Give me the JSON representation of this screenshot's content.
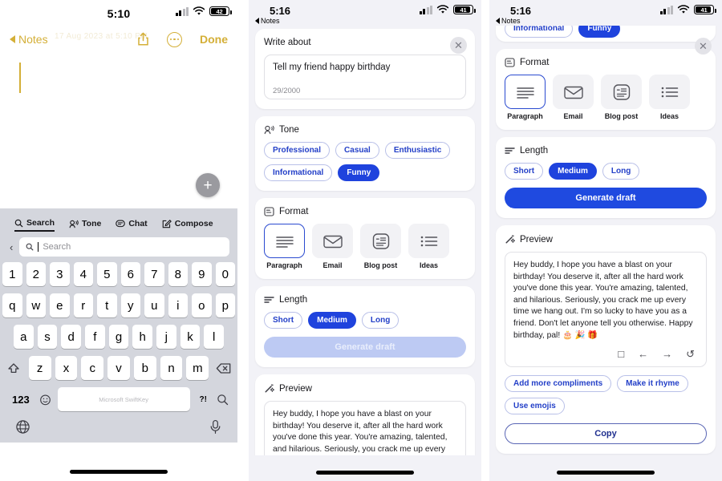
{
  "panel1": {
    "name": "notes-editor-with-keyboard",
    "status": {
      "time": "5:10",
      "battery_pct": "42",
      "signal_icon": "cellular-bars-icon",
      "wifi_icon": "wifi-icon",
      "battery_icon": "battery-icon"
    },
    "nav": {
      "back_label": "Notes",
      "done_label": "Done",
      "share_icon": "share-icon",
      "more_icon": "ellipsis-circle-icon"
    },
    "watermark": "17 Aug 2023 at 5:10 PM",
    "fab_icon": "plus-icon",
    "keyboard": {
      "tabs": [
        {
          "label": "Search",
          "icon": "search-icon",
          "active": true
        },
        {
          "label": "Tone",
          "icon": "tone-icon",
          "active": false
        },
        {
          "label": "Chat",
          "icon": "chat-icon",
          "active": false
        },
        {
          "label": "Compose",
          "icon": "compose-icon",
          "active": false
        }
      ],
      "back_icon": "chevron-left-icon",
      "search_placeholder": "Search",
      "search_value": "",
      "search_icon": "search-icon",
      "row_numbers": [
        "1",
        "2",
        "3",
        "4",
        "5",
        "6",
        "7",
        "8",
        "9",
        "0"
      ],
      "row_top": [
        "q",
        "w",
        "e",
        "r",
        "t",
        "y",
        "u",
        "i",
        "o",
        "p"
      ],
      "row_mid": [
        "a",
        "s",
        "d",
        "f",
        "g",
        "h",
        "j",
        "k",
        "l"
      ],
      "row_bot": [
        "z",
        "x",
        "c",
        "v",
        "b",
        "n",
        "m"
      ],
      "shift_icon": "shift-icon",
      "backspace_icon": "backspace-icon",
      "numbers_label": "123",
      "emoji_icon": "emoji-icon",
      "space_label": "Microsoft SwiftKey",
      "punct_label": "?!",
      "search_key_icon": "search-icon",
      "globe_icon": "globe-icon",
      "mic_icon": "microphone-icon"
    }
  },
  "panel2": {
    "name": "copilot-compose-sheet-top",
    "status": {
      "time": "5:16",
      "back_label": "Notes",
      "battery_pct": "41"
    },
    "close_icon": "close-icon",
    "write_about": {
      "title": "Write about",
      "value": "Tell my friend happy birthday",
      "counter": "29/2000"
    },
    "tone": {
      "title": "Tone",
      "icon": "tone-icon",
      "options": [
        {
          "label": "Professional",
          "selected": false
        },
        {
          "label": "Casual",
          "selected": false
        },
        {
          "label": "Enthusiastic",
          "selected": false
        },
        {
          "label": "Informational",
          "selected": false
        },
        {
          "label": "Funny",
          "selected": true
        }
      ]
    },
    "format": {
      "title": "Format",
      "icon": "format-icon",
      "options": [
        {
          "label": "Paragraph",
          "icon": "paragraph-icon",
          "selected": true
        },
        {
          "label": "Email",
          "icon": "email-icon",
          "selected": false
        },
        {
          "label": "Blog post",
          "icon": "blog-post-icon",
          "selected": false
        },
        {
          "label": "Ideas",
          "icon": "ideas-icon",
          "selected": false
        }
      ]
    },
    "length": {
      "title": "Length",
      "icon": "length-icon",
      "options": [
        {
          "label": "Short",
          "selected": false
        },
        {
          "label": "Medium",
          "selected": true
        },
        {
          "label": "Long",
          "selected": false
        }
      ]
    },
    "generate_label": "Generate draft",
    "generate_enabled": false,
    "preview": {
      "title": "Preview",
      "icon": "magic-wand-icon",
      "text": "Hey buddy, I hope you have a blast on your birthday! You deserve it, after all the hard work you've done this year. You're amazing, talented, and hilarious. Seriously, you crack me up every time we hang out. I'm so lucky to have you as a friend. Don't let anyone tell you otherwise. Happy"
    }
  },
  "panel3": {
    "name": "copilot-compose-sheet-scrolled",
    "status": {
      "time": "5:16",
      "back_label": "Notes",
      "battery_pct": "41"
    },
    "close_icon": "close-icon",
    "tone_partial": [
      {
        "label": "Informational",
        "selected": false
      },
      {
        "label": "Funny",
        "selected": true
      }
    ],
    "format": {
      "title": "Format",
      "icon": "format-icon",
      "options": [
        {
          "label": "Paragraph",
          "icon": "paragraph-icon",
          "selected": true
        },
        {
          "label": "Email",
          "icon": "email-icon",
          "selected": false
        },
        {
          "label": "Blog post",
          "icon": "blog-post-icon",
          "selected": false
        },
        {
          "label": "Ideas",
          "icon": "ideas-icon",
          "selected": false
        }
      ]
    },
    "length": {
      "title": "Length",
      "icon": "length-icon",
      "options": [
        {
          "label": "Short",
          "selected": false
        },
        {
          "label": "Medium",
          "selected": true
        },
        {
          "label": "Long",
          "selected": false
        }
      ]
    },
    "generate_label": "Generate draft",
    "preview": {
      "title": "Preview",
      "icon": "magic-wand-icon",
      "text": "Hey buddy, I hope you have a blast on your birthday! You deserve it, after all the hard work you've done this year. You're amazing, talented, and hilarious. Seriously, you crack me up every time we hang out. I'm so lucky to have you as a friend. Don't let anyone tell you otherwise. Happy birthday, pal! 🎂 🎉 🎁",
      "actions": [
        {
          "icon": "stop-icon",
          "glyph": "□"
        },
        {
          "icon": "previous-arrow-icon",
          "glyph": "←"
        },
        {
          "icon": "next-arrow-icon",
          "glyph": "→"
        },
        {
          "icon": "regenerate-icon",
          "glyph": "↺"
        }
      ]
    },
    "suggestions": [
      {
        "label": "Add more compliments"
      },
      {
        "label": "Make it rhyme"
      },
      {
        "label": "Use emojis"
      }
    ],
    "copy_label": "Copy"
  },
  "colors": {
    "accent_blue": "#1f4ae0",
    "chip_border": "#b9c0e8",
    "notes_gold": "#d4af37",
    "sheet_bg": "#f2f2f7",
    "keyboard_bg": "#d4d6dd"
  }
}
